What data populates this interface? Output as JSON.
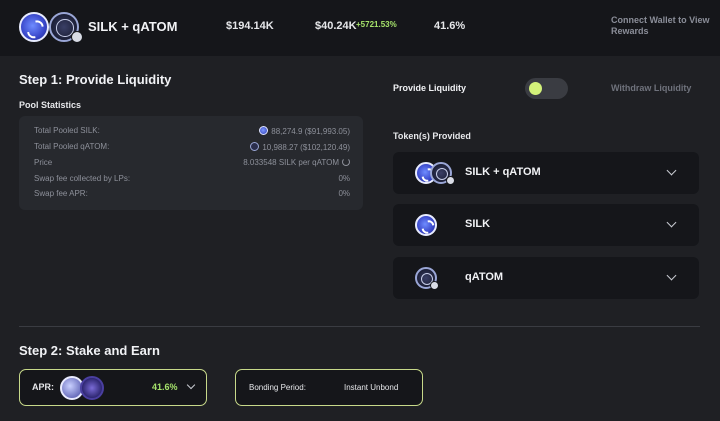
{
  "header": {
    "pair": "SILK + qATOM",
    "tvl": "$194.14K",
    "volume": "$40.24K",
    "volume_change": "+5721.53%",
    "apr": "41.6%",
    "connect_wallet": "Connect Wallet to View Rewards"
  },
  "step1": {
    "title": "Step 1: Provide Liquidity",
    "pool_stats_title": "Pool Statistics",
    "stats": [
      {
        "label": "Total Pooled SILK:",
        "value": "88,274.9 ($91,993.05)"
      },
      {
        "label": "Total Pooled qATOM:",
        "value": "10,988.27 ($102,120.49)"
      },
      {
        "label": "Price",
        "value": "8.033548 SILK per qATOM"
      },
      {
        "label": "Swap fee collected by LPs:",
        "value": "0%"
      },
      {
        "label": "Swap fee APR:",
        "value": "0%"
      }
    ]
  },
  "liquidity_toggle": {
    "provide_label": "Provide Liquidity",
    "withdraw_label": "Withdraw Liquidity",
    "active": "provide"
  },
  "tokens": {
    "title": "Token(s) Provided",
    "items": [
      {
        "name": "SILK + qATOM",
        "icons": [
          "silk-icon",
          "qatom-icon"
        ]
      },
      {
        "name": "SILK",
        "icons": [
          "silk-icon"
        ]
      },
      {
        "name": "qATOM",
        "icons": [
          "qatom-icon"
        ]
      }
    ]
  },
  "step2": {
    "title": "Step 2: Stake and Earn",
    "apr_label": "APR:",
    "apr_value": "41.6%",
    "bonding_label": "Bonding Period:",
    "bonding_value": "Instant Unbond"
  },
  "colors": {
    "accent_green": "#a6e36b",
    "toggle_knob": "#d3f27a",
    "border_accent": "#c7d98a",
    "background": "#1f2024",
    "card": "#15161a"
  }
}
